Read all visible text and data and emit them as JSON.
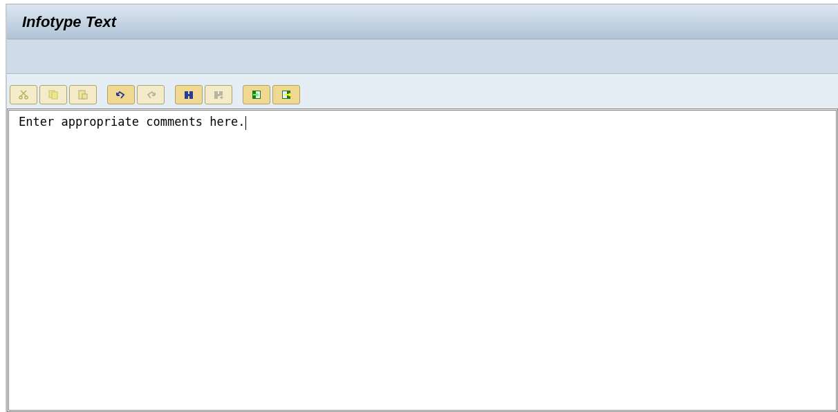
{
  "window": {
    "title": "Infotype Text"
  },
  "toolbar_groups": [
    {
      "buttons": [
        {
          "kind": "cut",
          "disabled": true
        },
        {
          "kind": "copy",
          "disabled": true
        },
        {
          "kind": "paste",
          "disabled": true
        }
      ]
    },
    {
      "buttons": [
        {
          "kind": "undo",
          "disabled": false
        },
        {
          "kind": "redo",
          "disabled": true
        }
      ]
    },
    {
      "buttons": [
        {
          "kind": "find",
          "disabled": false
        },
        {
          "kind": "find-next",
          "disabled": true
        }
      ]
    },
    {
      "buttons": [
        {
          "kind": "import",
          "disabled": false
        },
        {
          "kind": "export",
          "disabled": false
        }
      ]
    }
  ],
  "editor": {
    "value": "Enter appropriate comments here."
  }
}
